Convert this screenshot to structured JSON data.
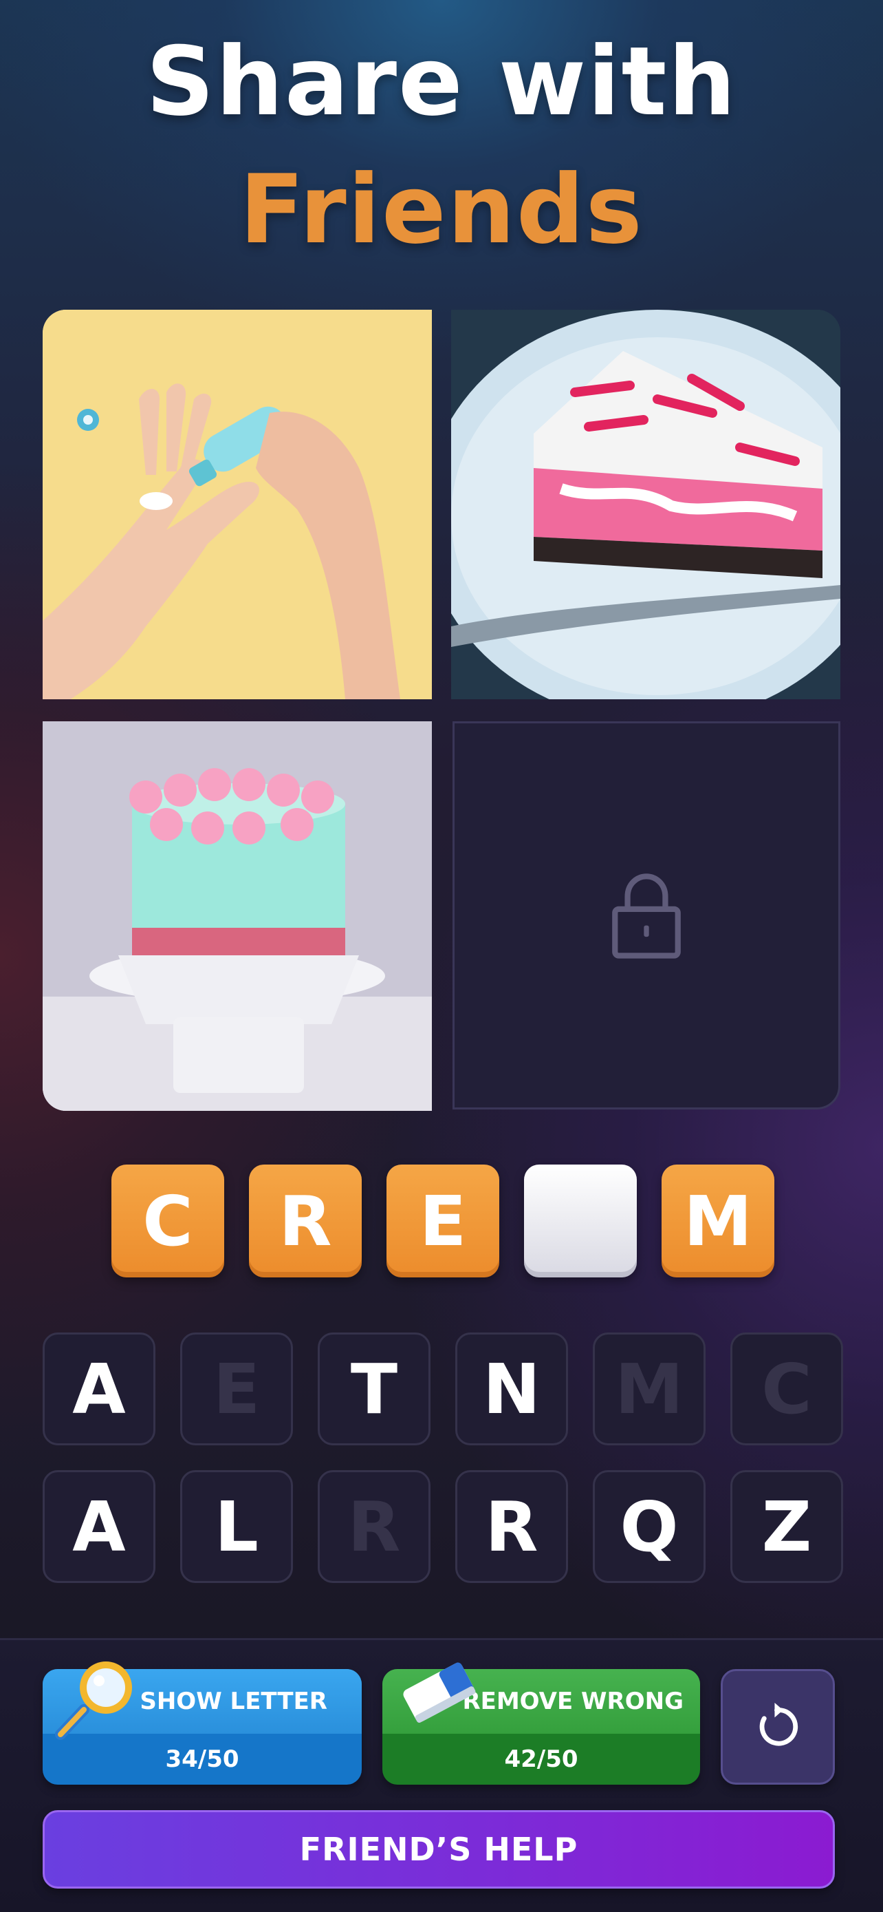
{
  "header": {
    "title_line1": "Share with",
    "title_line2": "Friends",
    "accent_color": "#e8923a"
  },
  "images": [
    {
      "name": "hand-cream",
      "locked": false
    },
    {
      "name": "cake-slice",
      "locked": false
    },
    {
      "name": "cake",
      "locked": false
    },
    {
      "name": "locked",
      "locked": true,
      "icon": "lock-icon"
    }
  ],
  "answer": {
    "letters": [
      "C",
      "R",
      "E",
      "",
      "M"
    ]
  },
  "keyboard": {
    "row1": [
      {
        "letter": "A",
        "used": false
      },
      {
        "letter": "E",
        "used": true
      },
      {
        "letter": "T",
        "used": false
      },
      {
        "letter": "N",
        "used": false
      },
      {
        "letter": "M",
        "used": true
      },
      {
        "letter": "C",
        "used": true
      }
    ],
    "row2": [
      {
        "letter": "A",
        "used": false
      },
      {
        "letter": "L",
        "used": false
      },
      {
        "letter": "R",
        "used": true
      },
      {
        "letter": "R",
        "used": false
      },
      {
        "letter": "Q",
        "used": false
      },
      {
        "letter": "Z",
        "used": false
      }
    ]
  },
  "hints": {
    "show_letter": {
      "label": "SHOW LETTER",
      "count": "34/50",
      "icon": "magnifier-icon"
    },
    "remove_wrong": {
      "label": "REMOVE WRONG",
      "count": "42/50",
      "icon": "eraser-icon"
    },
    "refresh": {
      "icon": "refresh-icon"
    }
  },
  "friends_help": {
    "label": "FRIEND’S HELP"
  }
}
